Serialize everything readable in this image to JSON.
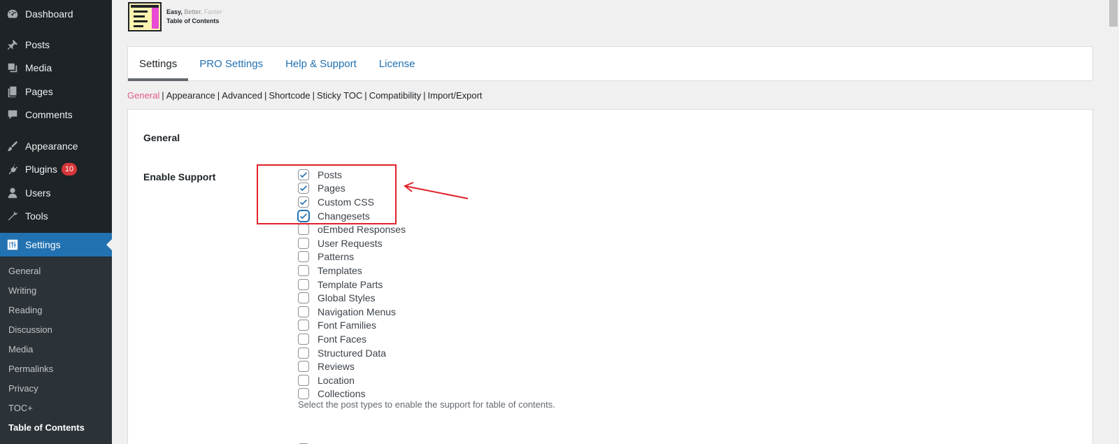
{
  "sidebar": {
    "items": [
      {
        "label": "Dashboard",
        "icon": "dashboard-icon"
      },
      {
        "label": "Posts",
        "icon": "pin-icon"
      },
      {
        "label": "Media",
        "icon": "media-icon"
      },
      {
        "label": "Pages",
        "icon": "pages-icon"
      },
      {
        "label": "Comments",
        "icon": "comment-icon"
      },
      {
        "label": "Appearance",
        "icon": "brush-icon"
      },
      {
        "label": "Plugins",
        "icon": "plugin-icon",
        "badge": "10"
      },
      {
        "label": "Users",
        "icon": "user-icon"
      },
      {
        "label": "Tools",
        "icon": "wrench-icon"
      },
      {
        "label": "Settings",
        "icon": "settings-icon",
        "active": true
      }
    ],
    "submenu": [
      "General",
      "Writing",
      "Reading",
      "Discussion",
      "Media",
      "Permalinks",
      "Privacy",
      "TOC+",
      "Table of Contents"
    ]
  },
  "logo": {
    "tag_easy": "Easy,",
    "tag_better": "Better,",
    "tag_faster": "Faster",
    "name": "Table of Contents"
  },
  "tabs": [
    "Settings",
    "PRO Settings",
    "Help & Support",
    "License"
  ],
  "subnav": [
    "General",
    "Appearance",
    "Advanced",
    "Shortcode",
    "Sticky TOC",
    "Compatibility",
    "Import/Export"
  ],
  "panel": {
    "section_title": "General",
    "field_label": "Enable Support",
    "options": [
      {
        "label": "Posts",
        "checked": true
      },
      {
        "label": "Pages",
        "checked": true
      },
      {
        "label": "Custom CSS",
        "checked": true
      },
      {
        "label": "Changesets",
        "checked": true
      },
      {
        "label": "oEmbed Responses",
        "checked": false
      },
      {
        "label": "User Requests",
        "checked": false
      },
      {
        "label": "Patterns",
        "checked": false
      },
      {
        "label": "Templates",
        "checked": false
      },
      {
        "label": "Template Parts",
        "checked": false
      },
      {
        "label": "Global Styles",
        "checked": false
      },
      {
        "label": "Navigation Menus",
        "checked": false
      },
      {
        "label": "Font Families",
        "checked": false
      },
      {
        "label": "Font Faces",
        "checked": false
      },
      {
        "label": "Structured Data",
        "checked": false
      },
      {
        "label": "Reviews",
        "checked": false
      },
      {
        "label": "Location",
        "checked": false
      },
      {
        "label": "Collections",
        "checked": false
      }
    ],
    "description": "Select the post types to enable the support for table of contents."
  },
  "colors": {
    "sidebar_bg": "#1d2327",
    "accent": "#2271b1",
    "badge": "#d63638",
    "annotation": "#e0212b",
    "subnav_active": "#e25b7f"
  }
}
